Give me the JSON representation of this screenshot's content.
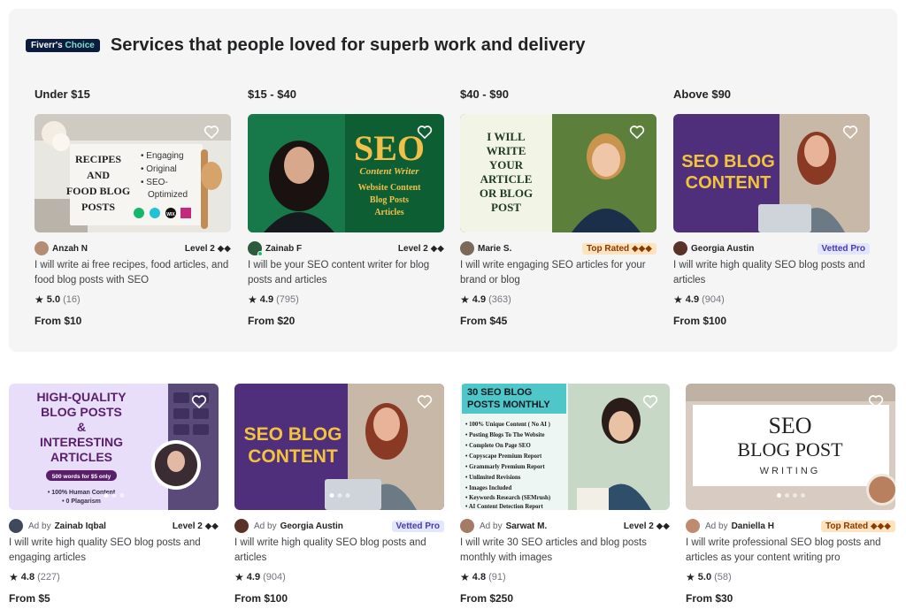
{
  "choice": {
    "badge_main": "Fiverr's",
    "badge_accent": "Choice",
    "title": "Services that people loved for superb work and delivery",
    "tiers": [
      "Under $15",
      "$15 - $40",
      "$40 - $90",
      "Above $90"
    ]
  },
  "top_cards": [
    {
      "seller": "Anzah N",
      "badge": "Level 2 ◆◆",
      "title": "I will write ai free recipes, food articles, and food blog posts with SEO",
      "rating": "5.0",
      "count": "(16)",
      "price": "From $10",
      "thumb": {
        "left": [
          "RECIPES",
          "AND",
          "FOOD BLOG",
          "POSTS"
        ],
        "bullets": [
          "• Engaging",
          "• Original",
          "• SEO-",
          "Optimized"
        ],
        "logo_text": "WIX"
      }
    },
    {
      "seller": "Zainab F",
      "badge": "Level 2 ◆◆",
      "title": "I will be your SEO content writer for blog posts and articles",
      "rating": "4.9",
      "count": "(795)",
      "price": "From $20",
      "thumb": {
        "big": "SEO",
        "script": "Content Writer",
        "lines": [
          "Website Content",
          "Blog Posts",
          "Articles"
        ]
      }
    },
    {
      "seller": "Marie S.",
      "badge": "Top Rated ◆◆◆",
      "title": "I will write engaging SEO articles for your brand or blog",
      "rating": "4.9",
      "count": "(363)",
      "price": "From $45",
      "thumb": {
        "lines": [
          "I WILL",
          "WRITE",
          "YOUR",
          "ARTICLE",
          "OR BLOG",
          "POST"
        ]
      }
    },
    {
      "seller": "Georgia Austin",
      "badge": "Vetted Pro",
      "title": "I will write high quality SEO blog posts and articles",
      "rating": "4.9",
      "count": "(904)",
      "price": "From $100",
      "thumb": {
        "lines": [
          "SEO BLOG",
          "CONTENT"
        ]
      }
    }
  ],
  "bottom_cards": [
    {
      "ad": "Ad by",
      "seller": "Zainab Iqbal",
      "badge": "Level 2 ◆◆",
      "title": "I will write high quality SEO blog posts and engaging articles",
      "rating": "4.8",
      "count": "(227)",
      "price": "From $5",
      "thumb": {
        "lines": [
          "HIGH-QUALITY",
          "BLOG POSTS",
          "&",
          "INTERESTING",
          "ARTICLES"
        ],
        "pill": "500 words for $5 only",
        "sub": [
          "• 100% Human Content",
          "• 0 Plagarism"
        ]
      }
    },
    {
      "ad": "Ad by",
      "seller": "Georgia Austin",
      "badge": "Vetted Pro",
      "title": "I will write high quality SEO blog posts and articles",
      "rating": "4.9",
      "count": "(904)",
      "price": "From $100",
      "thumb": {
        "lines": [
          "SEO BLOG",
          "CONTENT"
        ]
      }
    },
    {
      "ad": "Ad by",
      "seller": "Sarwat M.",
      "badge": "Level 2 ◆◆",
      "title": "I will write 30 SEO articles and blog posts monthly with images",
      "rating": "4.8",
      "count": "(91)",
      "price": "From $250",
      "thumb": {
        "heading": [
          "30 SEO BLOG",
          "POSTS MONTHLY"
        ],
        "list": [
          "• 100% Unique Content ( No AI )",
          "• Posting Blogs To The Website",
          "• Complete On Page SEO",
          "• Copyscape Premium Report",
          "• Grammarly Premium Report",
          "• Unlimited Revisions",
          "• Images Included",
          "• Keywords Research (SEMrush)",
          "• AI Content Detection Report"
        ]
      }
    },
    {
      "ad": "Ad by",
      "seller": "Daniella H",
      "badge": "Top Rated ◆◆◆",
      "title": "I will write professional SEO blog posts and articles as your content writing pro",
      "rating": "5.0",
      "count": "(58)",
      "price": "From $30",
      "thumb": {
        "lines": [
          "SEO",
          "BLOG POST",
          "WRITING"
        ]
      }
    }
  ],
  "colors": {
    "brand_green": "#1dbf73",
    "badge_navy": "#0b1c3f",
    "top_rated_bg": "#ffe2be",
    "vetted_bg": "#e2e6fe"
  }
}
